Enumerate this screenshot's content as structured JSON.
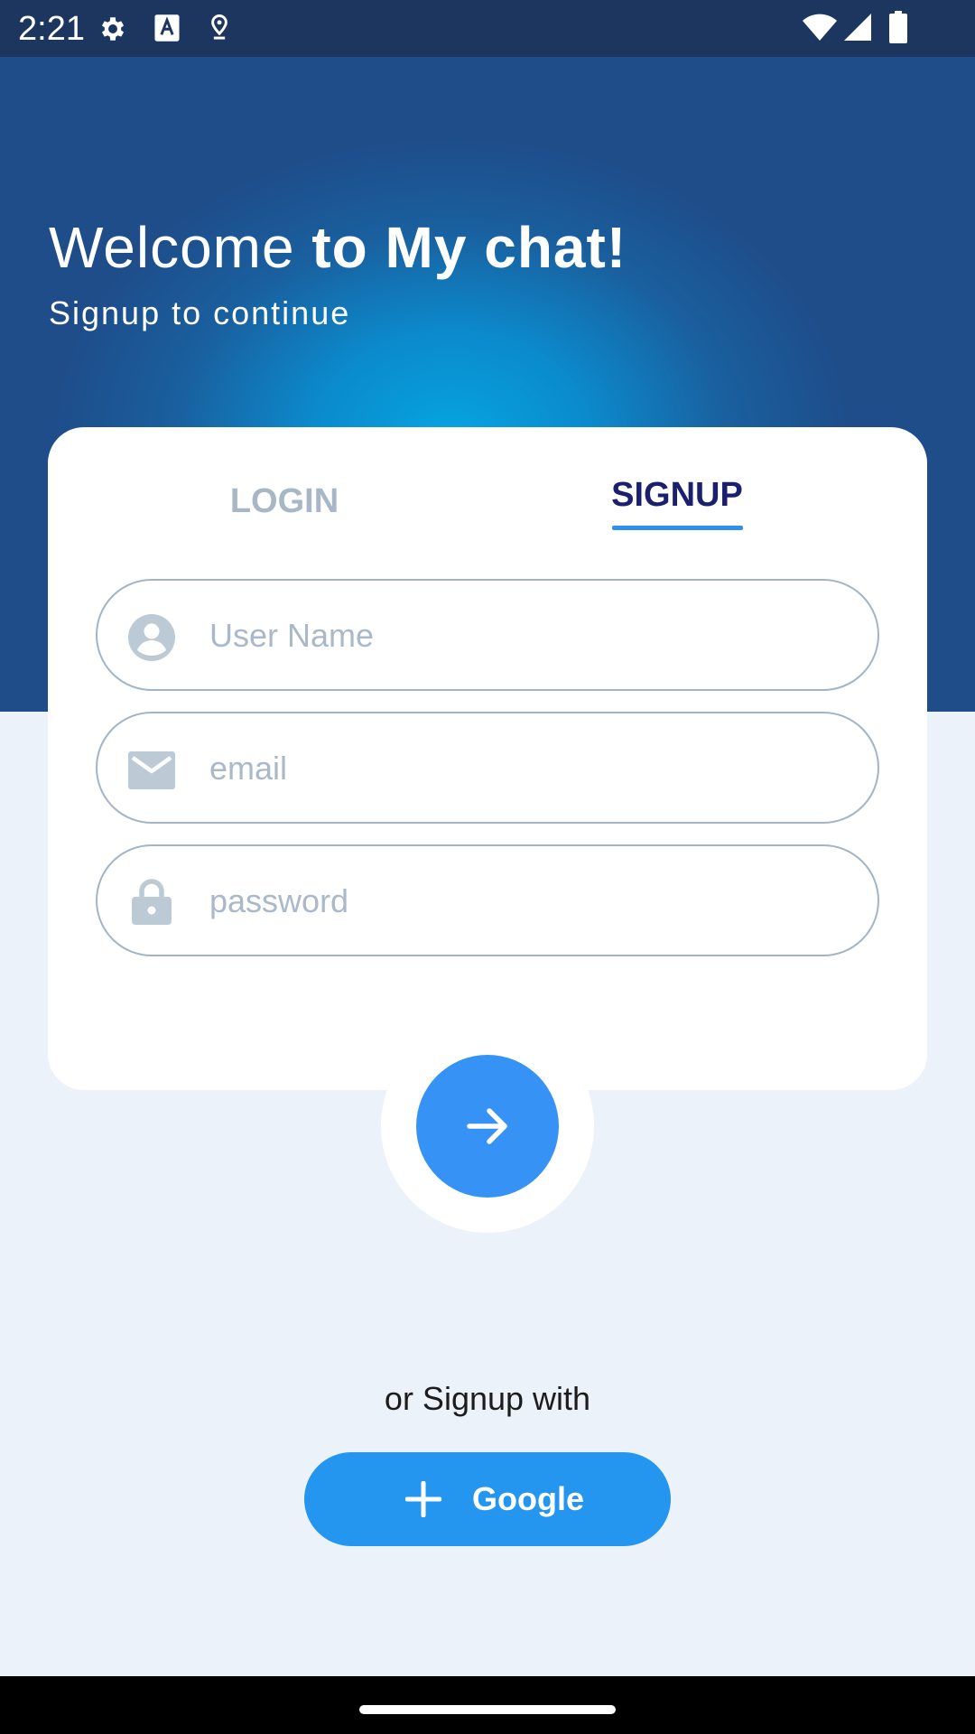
{
  "status_bar": {
    "time": "2:21",
    "icons_left": [
      "gear-icon",
      "text-a-icon",
      "location-pin-icon"
    ],
    "icons_right": [
      "wifi-icon",
      "cell-signal-icon",
      "battery-icon"
    ]
  },
  "header": {
    "welcome_prefix": "Welcome ",
    "welcome_bold": "to My chat!",
    "subtitle": "Signup to continue"
  },
  "tabs": {
    "login_label": "LOGIN",
    "signup_label": "SIGNUP",
    "active": "SIGNUP"
  },
  "form": {
    "username": {
      "placeholder": "User Name",
      "value": "",
      "icon": "user-circle-icon"
    },
    "email": {
      "placeholder": "email",
      "value": "",
      "icon": "envelope-icon"
    },
    "password": {
      "placeholder": "password",
      "value": "",
      "icon": "lock-icon"
    }
  },
  "submit": {
    "icon": "arrow-right-icon"
  },
  "social": {
    "prompt": "or Signup with",
    "google_label": "Google",
    "google_icon": "plus-icon"
  },
  "colors": {
    "status_bar": "#1c365f",
    "hero_center": "#06a4e0",
    "hero_edge": "#1e4d8a",
    "background": "#ecf2f9",
    "tab_active": "#1a1f6e",
    "tab_inactive": "#a7b7c6",
    "accent": "#3693f5",
    "google_button": "#2596ef",
    "field_border": "#a3b5c5"
  }
}
